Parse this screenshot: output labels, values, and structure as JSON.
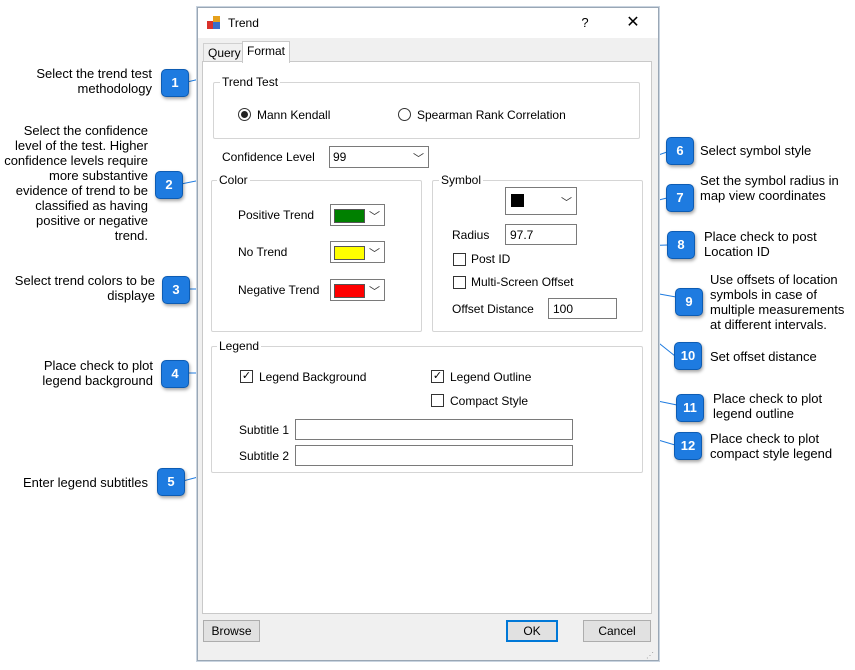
{
  "dialog": {
    "title": "Trend",
    "help_glyph": "?",
    "close_glyph": "✕",
    "tabs": [
      {
        "label": "Query"
      },
      {
        "label": "Format"
      }
    ],
    "trend_test": {
      "title": "Trend Test",
      "options": [
        {
          "label": "Mann Kendall",
          "selected": true
        },
        {
          "label": "Spearman Rank Correlation",
          "selected": false
        }
      ]
    },
    "confidence": {
      "label": "Confidence Level",
      "value": "99"
    },
    "color": {
      "title": "Color",
      "rows": [
        {
          "label": "Positive Trend",
          "color": "#008000"
        },
        {
          "label": "No Trend",
          "color": "#ffff00"
        },
        {
          "label": "Negative Trend",
          "color": "#ff0000"
        }
      ]
    },
    "symbol": {
      "title": "Symbol",
      "symbol_color": "#000000",
      "radius_label": "Radius",
      "radius_value": "97.7",
      "post_id_label": "Post ID",
      "post_id_checked": false,
      "multi_label": "Multi-Screen Offset",
      "multi_checked": false,
      "offset_label": "Offset Distance",
      "offset_value": "100"
    },
    "legend": {
      "title": "Legend",
      "background_label": "Legend Background",
      "background_checked": true,
      "outline_label": "Legend Outline",
      "outline_checked": true,
      "compact_label": "Compact Style",
      "compact_checked": false,
      "subtitle1_label": "Subtitle 1",
      "subtitle1_value": "",
      "subtitle2_label": "Subtitle 2",
      "subtitle2_value": ""
    },
    "buttons": {
      "browse": "Browse",
      "ok": "OK",
      "cancel": "Cancel"
    }
  },
  "callouts": [
    {
      "num": "1",
      "text": "Select the trend test methodology"
    },
    {
      "num": "2",
      "text": "Select the confidence level of the test.  Higher confidence levels require more substantive evidence of trend to be classified as having positive or negative trend."
    },
    {
      "num": "3",
      "text": "Select trend colors to be displaye"
    },
    {
      "num": "4",
      "text": "Place check to plot legend background"
    },
    {
      "num": "5",
      "text": "Enter legend subtitles"
    },
    {
      "num": "6",
      "text": "Select symbol style"
    },
    {
      "num": "7",
      "text": "Set the symbol radius in map view coordinates"
    },
    {
      "num": "8",
      "text": "Place check to post Location ID"
    },
    {
      "num": "9",
      "text": "Use offsets of location symbols in case of multiple measurements at different intervals."
    },
    {
      "num": "10",
      "text": "Set offset distance"
    },
    {
      "num": "11",
      "text": "Place check to plot legend outline"
    },
    {
      "num": "12",
      "text": "Place check to plot compact style legend"
    }
  ],
  "colors": {
    "badge": "#1e7be0",
    "leader": "#1e7be0"
  }
}
